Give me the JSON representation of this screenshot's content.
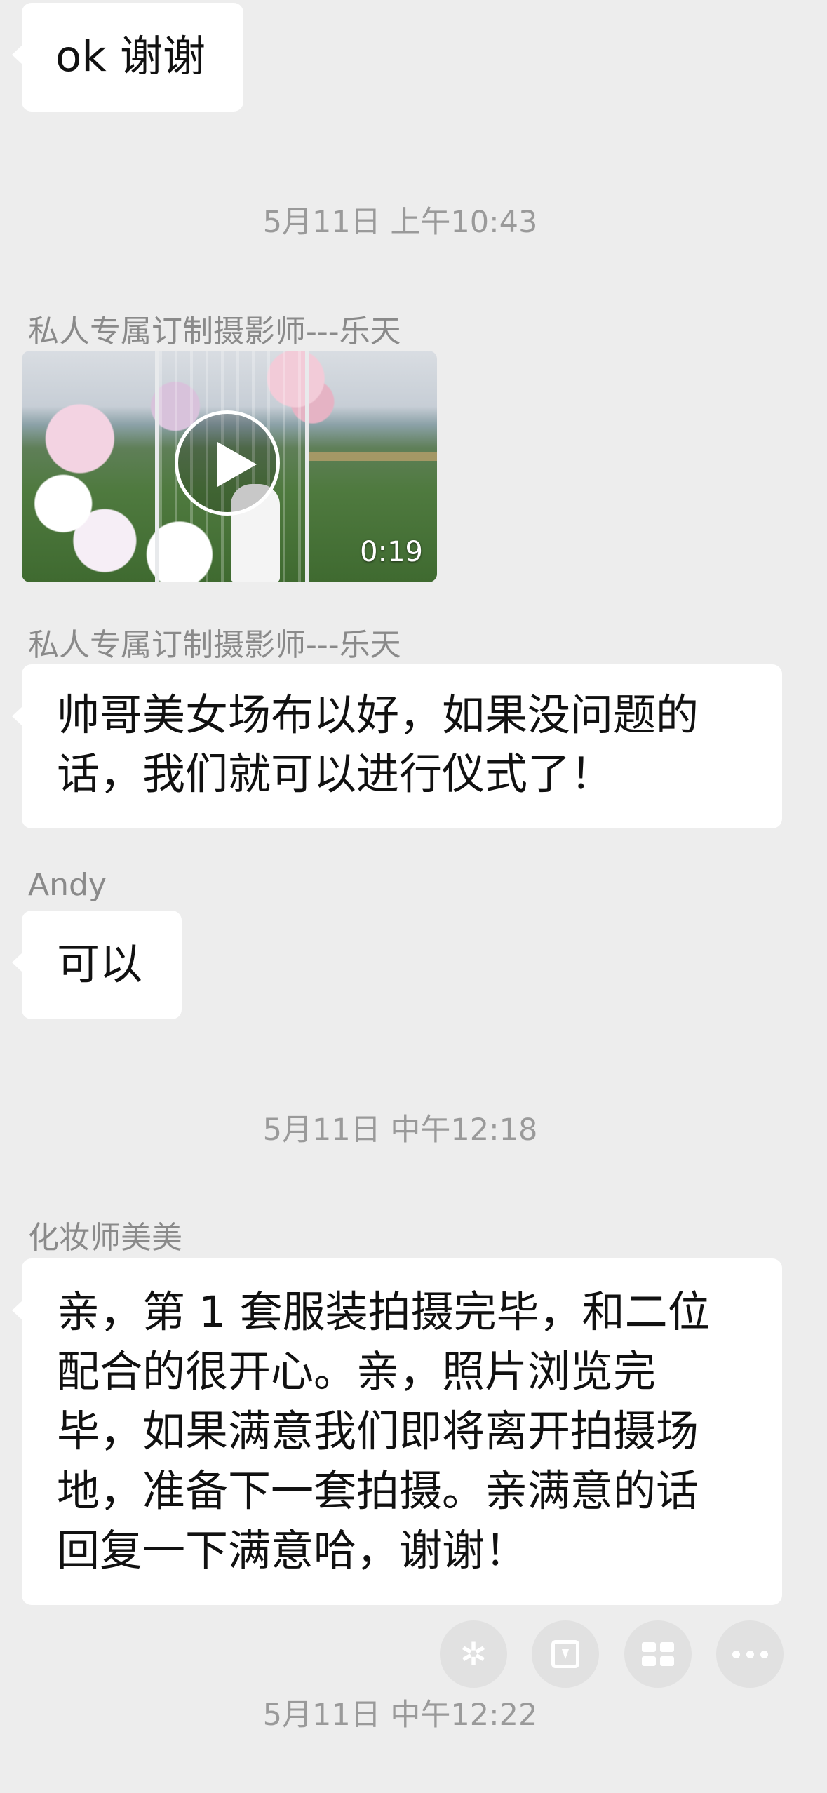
{
  "messages": [
    {
      "type": "text",
      "text": "ok 谢谢"
    },
    {
      "type": "time",
      "text": "5月11日 上午10:43"
    },
    {
      "type": "video",
      "sender": "私人专属订制摄影师---乐天",
      "duration": "0:19"
    },
    {
      "type": "text",
      "sender": "私人专属订制摄影师---乐天",
      "lines": [
        "帅哥美女场布以好，如果没问题的",
        "话，我们就可以进行仪式了！"
      ]
    },
    {
      "type": "text",
      "sender": "Andy",
      "text": "可以"
    },
    {
      "type": "time",
      "text": "5月11日 中午12:18"
    },
    {
      "type": "text",
      "sender": "化妆师美美",
      "lines": [
        "亲，第 1 套服装拍摄完毕，和二位",
        "配合的很开心。亲，照片浏览完",
        "毕，如果满意我们即将离开拍摄场",
        "地，准备下一套拍摄。亲满意的话",
        "回复一下满意哈，谢谢！"
      ]
    },
    {
      "type": "time",
      "text": "5月11日 中午12:22"
    }
  ],
  "action_icons": [
    "sparkle-icon",
    "download-icon",
    "grid-icon",
    "more-icon"
  ]
}
